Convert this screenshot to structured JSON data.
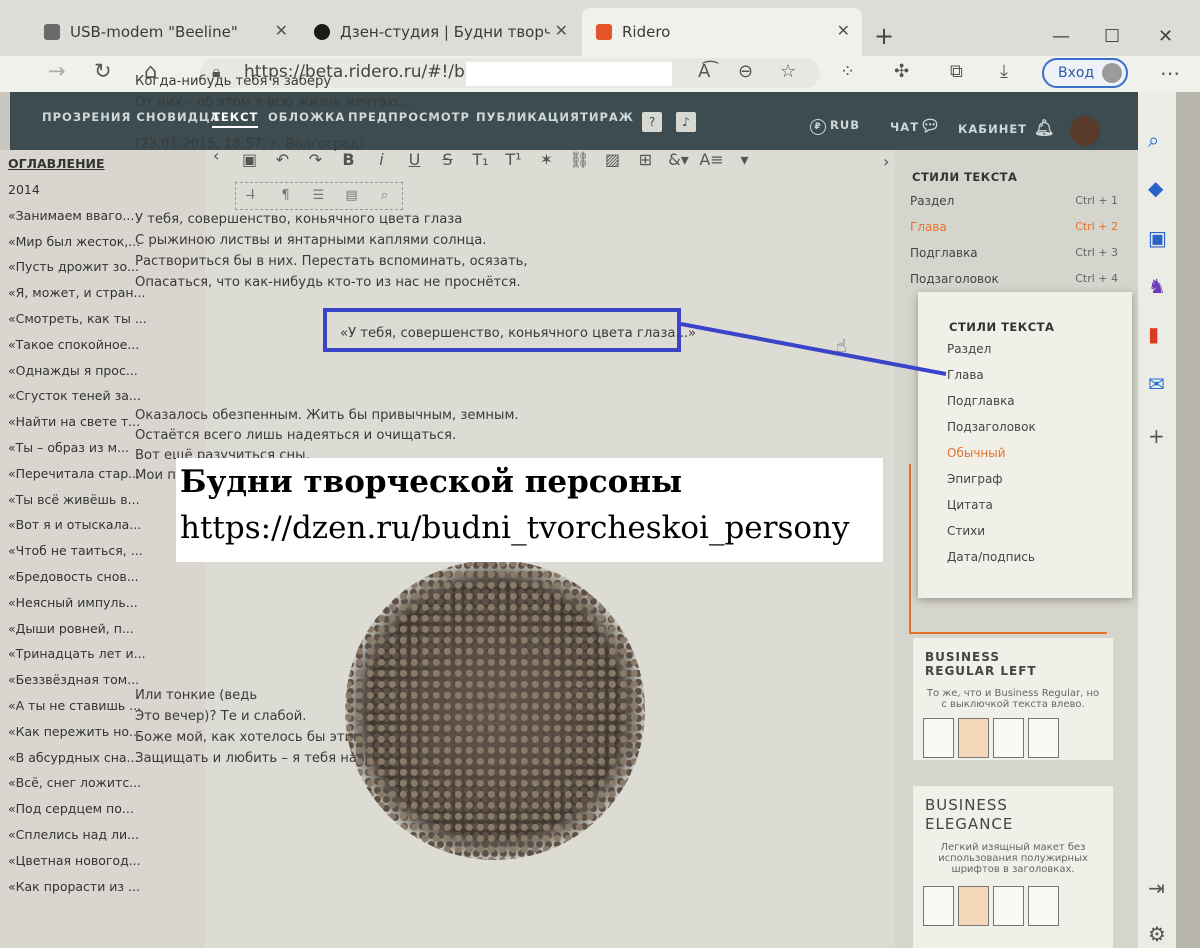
{
  "browser": {
    "tabs": [
      {
        "label": "USB-modem \"Beeline\""
      },
      {
        "label": "Дзен-студия | Будни творческо"
      },
      {
        "label": "Ridero"
      }
    ],
    "url": "https://beta.ridero.ru/#!/book/",
    "signin_label": "Вход",
    "new_tab": "+"
  },
  "app": {
    "menu": {
      "book_title": "ПРОЗРЕНИЯ СНОВИДЦА",
      "text": "ТЕКСТ",
      "cover": "ОБЛОЖКА",
      "preview": "ПРЕДПРОСМОТР",
      "publish": "ПУБЛИКАЦИЯ",
      "print_run": "ТИРАЖ",
      "help": "?",
      "currency": "RUB",
      "chat": "ЧАТ",
      "cabinet": "КАБИНЕТ"
    },
    "toc": {
      "heading": "ОГЛАВЛЕНИЕ",
      "items": [
        "2014",
        "«Занимаем вваго...",
        "«Мир был жесток,...",
        "«Пусть дрожит зо...",
        "«Я, может, и стран...",
        "«Смотреть, как ты ...",
        "«Такое спокойное...",
        "«Однажды я прос...",
        "«Сгусток теней за...",
        "«Найти на свете т...",
        "«Ты – образ из м...",
        "«Перечитала стар...",
        "«Ты всё живёшь в...",
        "«Вот я и отыскала...",
        "«Чтоб не таиться, ...",
        "«Бредовость снов...",
        "«Неясный импуль...",
        "«Дыши ровней, п...",
        "«Тринадцать лет и...",
        "«Беззвёздная том...",
        "«А ты не ставишь ...",
        "«Как пережить но...",
        "«В абсурдных сна...",
        "«Всё, снег ложитс...",
        "«Под сердцем по...",
        "«Сплелись над ли...",
        "«Цветная новогод...",
        "«Как прорасти из ..."
      ]
    },
    "doc": {
      "lines_top": [
        "Когда-нибудь тебя я заберу",
        "От них – об этом я всю жизнь мечтаю...",
        "",
        "(23.01.2015, 18:57, г. Волгоград)"
      ],
      "highlighted_heading": "«У тебя, совершенство, коньячного цвета глаза...»",
      "lines_mid": [
        "У тебя, совершенство, коньячного цвета глаза",
        "С рыжиною листвы и янтарными каплями солнца.",
        "Раствориться бы в них. Перестать вспоминать, осязать,",
        "Опасаться, что как-нибудь кто-то из нас не проснётся."
      ],
      "lines_low": [
        "Оказалось обезпенным. Жить бы привычным, земным.",
        "Остаётся всего лишь надеяться и очищаться.",
        "Вот ещё разучиться                    сны.",
        "Мои плечи то                          пальцы."
      ],
      "lines_bottom": [
        "Или тонкие                              (ведь",
        "Это вечер)? Те                    и слабой.",
        "Боже мой, как хотелось бы этим богатством владеть,",
        "Защищать и любить – я тебя навсегда забрала бы"
      ]
    },
    "styles_panel": {
      "heading": "СТИЛИ ТЕКСТА",
      "items": [
        {
          "label": "Раздел",
          "shortcut": "Ctrl + 1"
        },
        {
          "label": "Глава",
          "shortcut": "Ctrl + 2"
        },
        {
          "label": "Подглавка",
          "shortcut": "Ctrl + 3"
        },
        {
          "label": "Подзаголовок",
          "shortcut": "Ctrl + 4"
        }
      ]
    },
    "layouts": [
      {
        "title": "BUSINESS REGULAR LEFT",
        "desc": "То же, что и Business Regular, но с выключкой текста влево."
      },
      {
        "title": "BUSINESS ELEGANCE",
        "desc": "Легкий изящный макет без использования полужирных шрифтов в заголовках."
      }
    ],
    "popup": {
      "heading": "СТИЛИ ТЕКСТА",
      "items": [
        "Раздел",
        "Глава",
        "Подглавка",
        "Подзаголовок",
        "Обычный",
        "Эпиграф",
        "Цитата",
        "Стихи",
        "Дата/подпись"
      ],
      "selected": "Обычный"
    }
  },
  "overlay": {
    "title": "Будни творческой персоны",
    "url": "https://dzen.ru/budni_tvorcheskoi_persony"
  },
  "colors": {
    "accent_orange": "#e4732a",
    "highlight_blue": "#3a44c8",
    "appbar": "#3c4c50"
  }
}
